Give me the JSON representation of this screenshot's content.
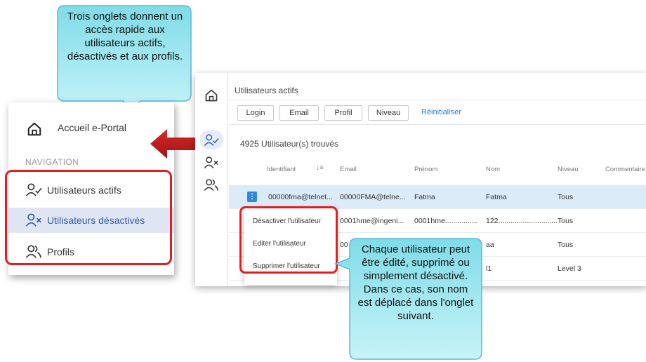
{
  "callouts": {
    "top": "Trois onglets donnent un accès rapide aux utilisateurs actifs, désactivés et aux profils.",
    "bottom": "Chaque utilisateur peut être édité, supprimé ou simplement désactivé. Dans ce cas, son nom est déplacé dans l'onglet suivant."
  },
  "nav": {
    "home_label": "Accueil e-Portal",
    "section_title": "NAVIGATION",
    "items": [
      {
        "label": "Utilisateurs actifs",
        "icon": "user-check-icon",
        "selected": false
      },
      {
        "label": "Utilisateurs désactivés",
        "icon": "user-x-icon",
        "selected": true
      },
      {
        "label": "Profils",
        "icon": "users-icon",
        "selected": false
      }
    ]
  },
  "app": {
    "title": "Utilisateurs actifs",
    "filters": [
      "Login",
      "Email",
      "Profil",
      "Niveau"
    ],
    "reset_label": "Réinitialiser",
    "count_text": "4925 Utilisateur(s) trouvés",
    "columns": [
      "Identifiant",
      "Email",
      "Prénom",
      "Nom",
      "Niveau",
      "Commentaire"
    ],
    "rows": [
      {
        "identifiant": "00000fma@telnet...",
        "email": "00000FMA@telne...",
        "prenom": "Fatma",
        "nom": "Fatma",
        "niveau": "Tous",
        "highlighted": true
      },
      {
        "identifiant": "",
        "email": "0001hme@ingeni...",
        "prenom": "0001hme................",
        "nom": "122.............................",
        "niveau": "Tous",
        "highlighted": false
      },
      {
        "identifiant": "",
        "email": "00",
        "prenom": "",
        "nom": "aa",
        "niveau": "Tous",
        "highlighted": false
      },
      {
        "identifiant": "",
        "email": "",
        "prenom": "",
        "nom": "l1",
        "niveau": "Level 3",
        "highlighted": false
      }
    ],
    "context_menu": [
      "Désactiver l'utilisateur",
      "Editer l'utilisateur",
      "Supprimer l'utilisateur"
    ]
  },
  "colors": {
    "callout_fill": "#a8ecf4",
    "callout_stroke": "#5bb8d6",
    "accent_blue": "#2b7fd6",
    "highlight_red": "#e02020",
    "selected_bg": "#dfe5f3"
  }
}
